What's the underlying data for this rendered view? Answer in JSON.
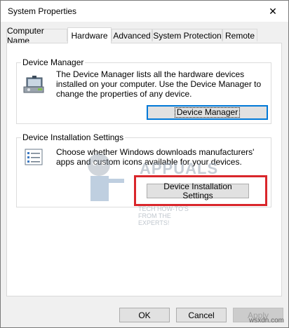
{
  "window": {
    "title": "System Properties",
    "close_glyph": "✕"
  },
  "tabs": [
    {
      "label": "Computer Name",
      "active": false
    },
    {
      "label": "Hardware",
      "active": true
    },
    {
      "label": "Advanced",
      "active": false
    },
    {
      "label": "System Protection",
      "active": false
    },
    {
      "label": "Remote",
      "active": false
    }
  ],
  "device_manager": {
    "group_title": "Device Manager",
    "description": "The Device Manager lists all the hardware devices installed on your computer. Use the Device Manager to change the properties of any device.",
    "button_label": "Device Manager",
    "icon": "device-manager-icon"
  },
  "device_installation": {
    "group_title": "Device Installation Settings",
    "description": "Choose whether Windows downloads manufacturers' apps and custom icons available for your devices.",
    "button_label": "Device Installation Settings",
    "icon": "checklist-icon"
  },
  "footer": {
    "ok_label": "OK",
    "cancel_label": "Cancel",
    "apply_label": "Apply"
  },
  "watermark": {
    "brand": "APPUALS",
    "tagline": "TECH HOW-TO'S FROM THE EXPERTS!"
  },
  "site_mark": "wsxdn.com",
  "colors": {
    "highlight": "#d9262b",
    "focus": "#0078d7"
  }
}
